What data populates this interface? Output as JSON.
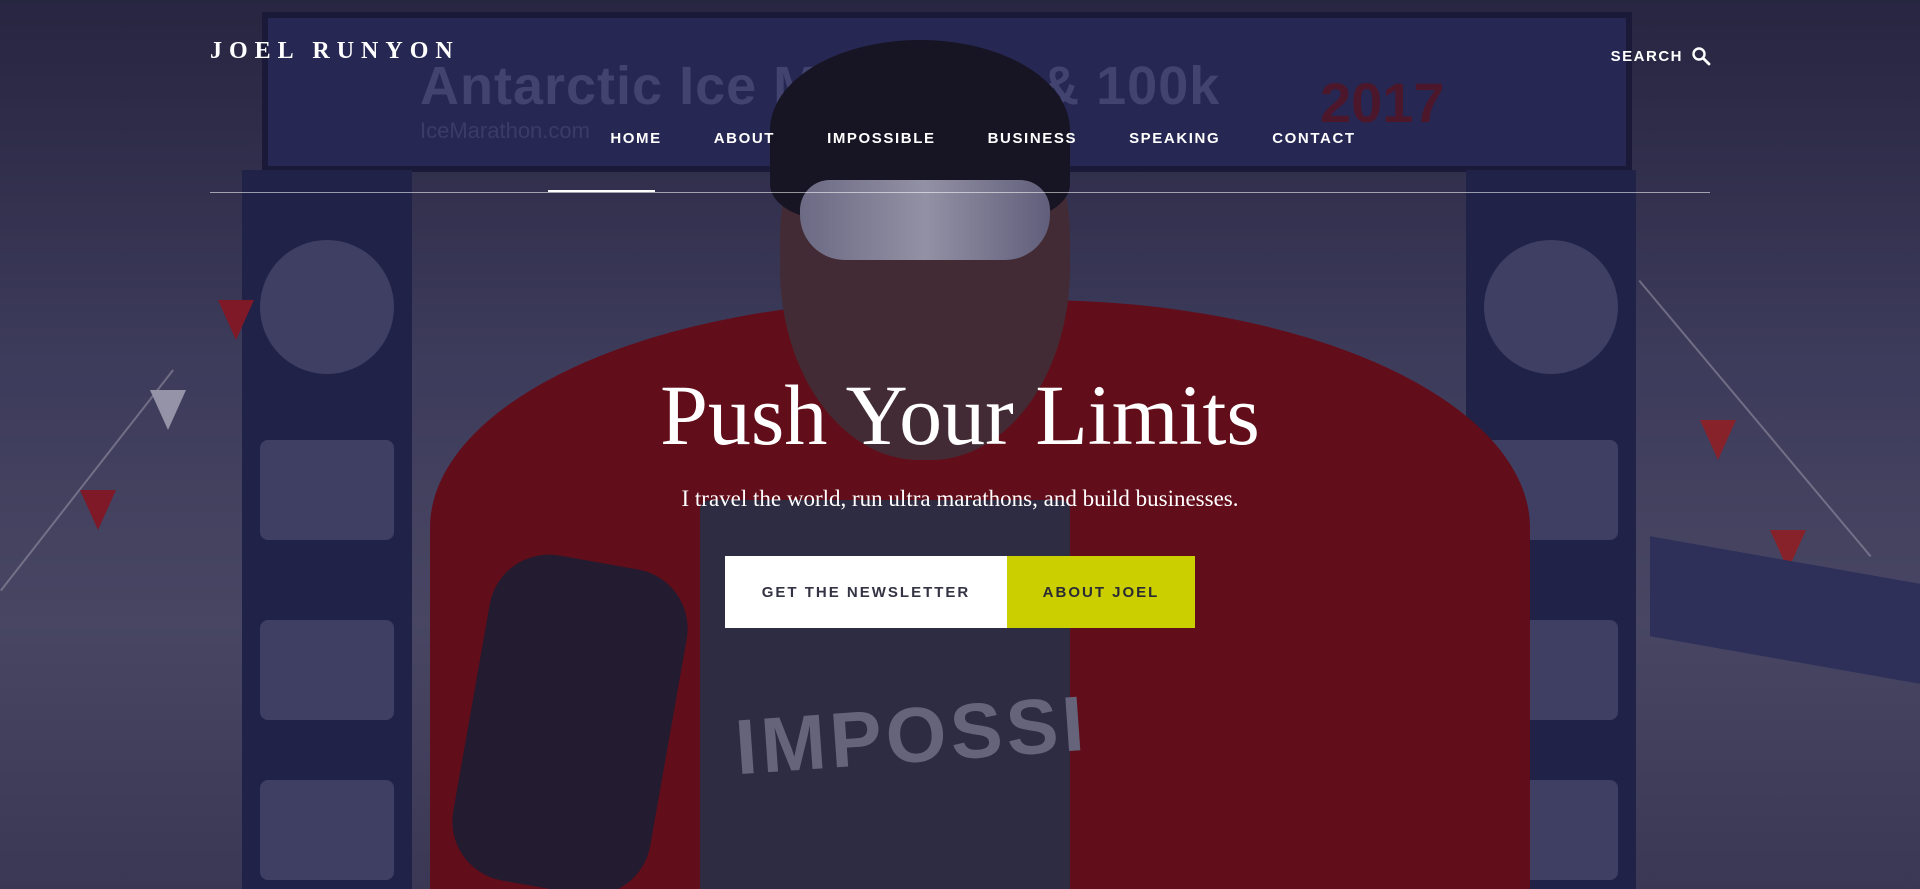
{
  "site": {
    "logo": "JOEL RUNYON"
  },
  "header": {
    "search_label": "SEARCH",
    "search_icon": "search-icon"
  },
  "nav": {
    "items": [
      {
        "label": "HOME",
        "active": true
      },
      {
        "label": "ABOUT",
        "active": false
      },
      {
        "label": "IMPOSSIBLE",
        "active": false
      },
      {
        "label": "BUSINESS",
        "active": false
      },
      {
        "label": "SPEAKING",
        "active": false
      },
      {
        "label": "CONTACT",
        "active": false
      }
    ]
  },
  "background": {
    "banner_text": "Antarctic Ice Marathon & 100k",
    "banner_year": "2017",
    "banner_sub": "IceMarathon.com",
    "shirt_text": "IMPOSSI"
  },
  "hero": {
    "title": "Push Your Limits",
    "subtitle": "I travel the world, run ultra marathons, and build businesses.",
    "buttons": {
      "newsletter": "GET THE NEWSLETTER",
      "about": "ABOUT JOEL"
    }
  },
  "colors": {
    "accent": "#cbcf00",
    "text": "#ffffff",
    "jacket": "#8b0a10"
  }
}
